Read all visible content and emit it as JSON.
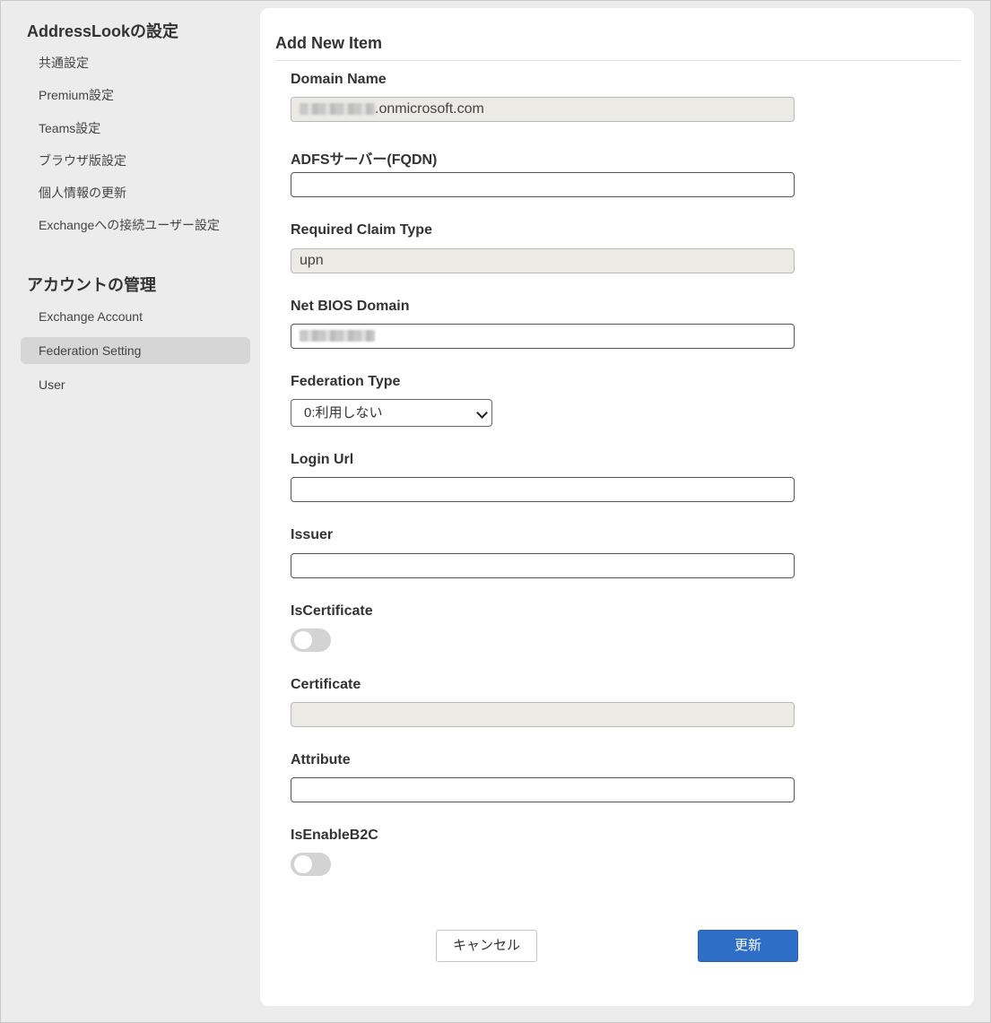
{
  "sidebar": {
    "section1_title": "AddressLookの設定",
    "section1_items": [
      "共通設定",
      "Premium設定",
      "Teams設定",
      "ブラウザ版設定",
      "個人情報の更新",
      "Exchangeへの接続ユーザー設定"
    ],
    "section2_title": "アカウントの管理",
    "section2_items": [
      "Exchange Account",
      "Federation Setting",
      "User"
    ],
    "active_item": "Federation Setting"
  },
  "form": {
    "title": "Add New Item",
    "domain_name": {
      "label": "Domain Name",
      "value": ".onmicrosoft.com"
    },
    "adfs_server": {
      "label": "ADFSサーバー(FQDN)",
      "value": ""
    },
    "required_claim_type": {
      "label": "Required Claim Type",
      "value": "upn"
    },
    "net_bios_domain": {
      "label": "Net BIOS Domain",
      "value": ""
    },
    "federation_type": {
      "label": "Federation Type",
      "selected": "0:利用しない"
    },
    "login_url": {
      "label": "Login Url",
      "value": ""
    },
    "issuer": {
      "label": "Issuer",
      "value": ""
    },
    "is_certificate": {
      "label": "IsCertificate",
      "on": false
    },
    "certificate": {
      "label": "Certificate",
      "value": ""
    },
    "attribute": {
      "label": "Attribute",
      "value": ""
    },
    "is_enable_b2c": {
      "label": "IsEnableB2C",
      "on": false
    }
  },
  "buttons": {
    "cancel": "キャンセル",
    "update": "更新"
  },
  "colors": {
    "primary": "#2e6ec6",
    "sidebar_bg": "#ececec",
    "active_nav": "#d6d6d6",
    "readonly_bg": "#ebeae5"
  },
  "icons": {
    "select_arrow": "chevron-down-icon"
  }
}
